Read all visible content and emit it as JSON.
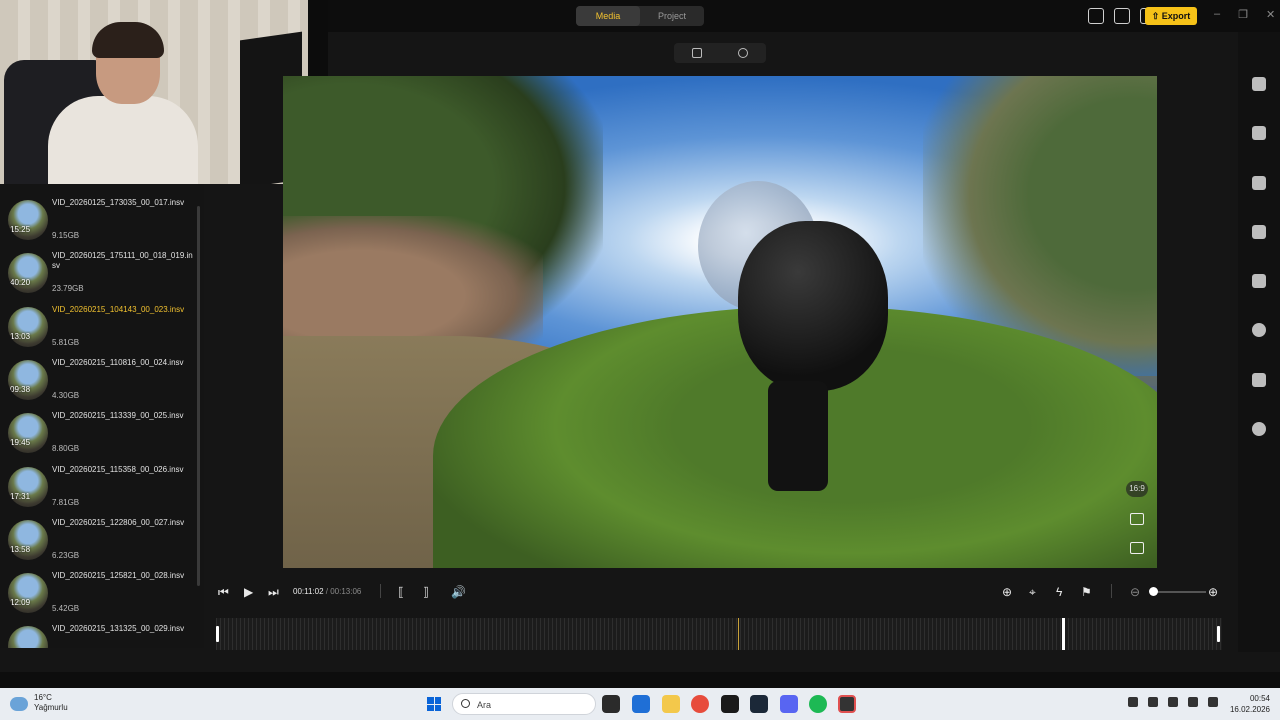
{
  "header": {
    "tabs": [
      {
        "label": "Media",
        "active": true
      },
      {
        "label": "Project",
        "active": false
      }
    ],
    "export_label": "Export",
    "toolbar_icons": [
      "layout-icon",
      "comment-icon",
      "checklist-icon",
      "update-icon"
    ],
    "window_controls": [
      "–",
      "❐",
      "✕"
    ],
    "accent_color": "#f6c218"
  },
  "media_list": [
    {
      "name": "VID_20260125_173035_00_017.insv",
      "size": "9.15GB",
      "duration": "15:25",
      "selected": false
    },
    {
      "name": "VID_20260125_175111_00_018_019.insv",
      "size": "23.79GB",
      "duration": "40:20",
      "selected": false
    },
    {
      "name": "VID_20260215_104143_00_023.insv",
      "size": "5.81GB",
      "duration": "13:03",
      "selected": true
    },
    {
      "name": "VID_20260215_110816_00_024.insv",
      "size": "4.30GB",
      "duration": "09:38",
      "selected": false
    },
    {
      "name": "VID_20260215_113339_00_025.insv",
      "size": "8.80GB",
      "duration": "19:45",
      "selected": false
    },
    {
      "name": "VID_20260215_115358_00_026.insv",
      "size": "7.81GB",
      "duration": "17:31",
      "selected": false
    },
    {
      "name": "VID_20260215_122806_00_027.insv",
      "size": "6.23GB",
      "duration": "13:58",
      "selected": false
    },
    {
      "name": "VID_20260215_125821_00_028.insv",
      "size": "5.42GB",
      "duration": "12:09",
      "selected": false
    },
    {
      "name": "VID_20260215_131325_00_029.insv",
      "size": "",
      "duration": "",
      "selected": false
    }
  ],
  "preview": {
    "aspect_badge": "16:9",
    "mode_icons": [
      "edit-icon",
      "eye-icon"
    ]
  },
  "playback": {
    "current_time": "00:11:02",
    "total_time": "/ 00:13:06",
    "position_fraction": 0.3
  },
  "right_sidebar_icons": [
    "video-icon",
    "puzzle-icon",
    "export-clip-icon",
    "audio-icon",
    "download-icon",
    "speed-icon",
    "folder-icon",
    "info-icon"
  ],
  "taskbar": {
    "temperature": "16°C",
    "weather": "Yağmurlu",
    "search_placeholder": "Ara",
    "time": "00:54",
    "date": "16.02.2026"
  }
}
